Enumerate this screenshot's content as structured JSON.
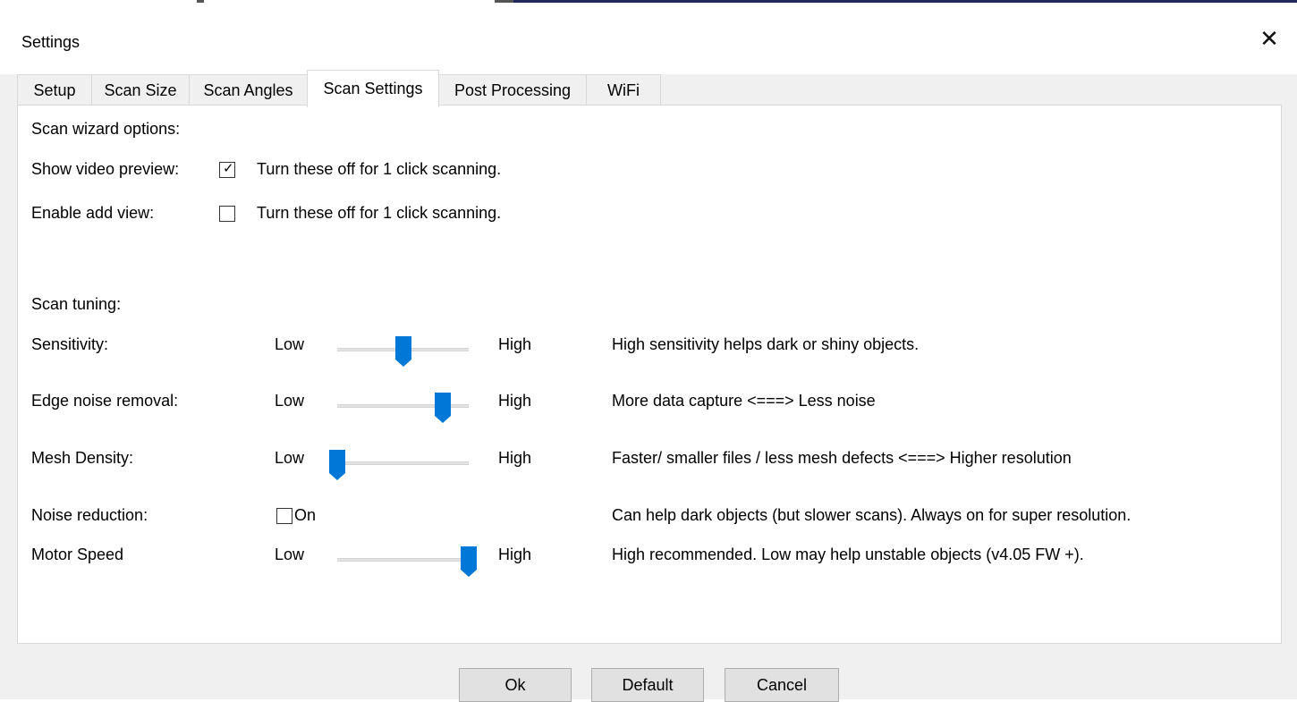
{
  "window": {
    "title": "Settings",
    "close_glyph": "✕"
  },
  "tabs": [
    {
      "label": "Setup",
      "active": false
    },
    {
      "label": "Scan Size",
      "active": false
    },
    {
      "label": "Scan Angles",
      "active": false
    },
    {
      "label": "Scan Settings",
      "active": true
    },
    {
      "label": "Post Processing",
      "active": false
    },
    {
      "label": "WiFi",
      "active": false
    }
  ],
  "wizard": {
    "heading": "Scan wizard options:",
    "show_video_preview": {
      "label": "Show video preview:",
      "checked": true,
      "note": "Turn these off for 1 click scanning."
    },
    "enable_add_view": {
      "label": "Enable add view:",
      "checked": false,
      "note": "Turn these off for 1 click scanning."
    }
  },
  "tuning": {
    "heading": "Scan tuning:",
    "low_label": "Low",
    "high_label": "High",
    "sensitivity": {
      "label": "Sensitivity:",
      "value": 0.5,
      "note": "High sensitivity helps dark or shiny objects."
    },
    "edge_noise": {
      "label": "Edge noise removal:",
      "value": 0.8,
      "note": "More data capture <===> Less noise"
    },
    "mesh_density": {
      "label": "Mesh Density:",
      "value": 0.0,
      "note": "Faster/ smaller files / less mesh defects <===> Higher resolution"
    },
    "noise_reduction": {
      "label": "Noise reduction:",
      "checked": false,
      "checkbox_label": "On",
      "note": "Can help dark objects (but slower scans). Always on for super resolution."
    },
    "motor_speed": {
      "label": "Motor Speed",
      "value": 1.0,
      "note": "High recommended.  Low may help unstable objects (v4.05 FW +)."
    }
  },
  "buttons": {
    "ok": "Ok",
    "default": "Default",
    "cancel": "Cancel"
  },
  "colors": {
    "accent": "#0078d7",
    "panel_bg": "#ffffff",
    "dialog_bg": "#f0f0f0"
  }
}
